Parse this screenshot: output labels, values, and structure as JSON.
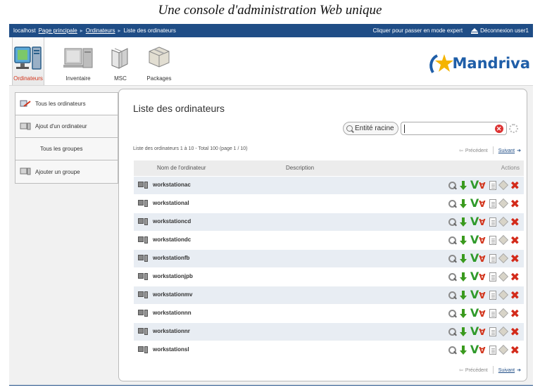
{
  "caption": "Une console d'administration Web unique",
  "topbar": {
    "host": "localhost",
    "crumb_home": "Page principale",
    "crumb_computers": "Ordinateurs",
    "crumb_current": "Liste des ordinateurs",
    "expert_link": "Cliquer pour passer en mode expert",
    "logout": "Déconnexion user1"
  },
  "modules": [
    {
      "label": "Ordinateurs",
      "icon": "computer-monitor-icon",
      "active": true
    },
    {
      "label": "Inventaire",
      "icon": "inventory-computers-icon",
      "active": false
    },
    {
      "label": "MSC",
      "icon": "msc-books-icon",
      "active": false
    },
    {
      "label": "Packages",
      "icon": "package-box-icon",
      "active": false
    }
  ],
  "brand": {
    "name": "Mandriva",
    "star_color": "#f5b400",
    "text_color": "#1f5ea8"
  },
  "sidebar": {
    "items": [
      {
        "label": "Tous les ordinateurs",
        "icon": "computers-list-icon",
        "selected": true
      },
      {
        "label": "Ajout d'un ordinateur",
        "icon": "add-computer-icon",
        "selected": false
      },
      {
        "label": "Tous les groupes",
        "icon": "",
        "selected": false
      },
      {
        "label": "Ajouter un groupe",
        "icon": "add-group-icon",
        "selected": false
      }
    ]
  },
  "main": {
    "title": "Liste des ordinateurs",
    "entity_label": "Entité racine",
    "search_value": "",
    "count_text": "Liste des ordinateurs 1 à 10 - Total 100 (page 1 / 10)",
    "prev_label": "Précédent",
    "next_label": "Suivant",
    "columns": {
      "name": "Nom de l'ordinateur",
      "description": "Description",
      "actions": "Actions"
    },
    "rows": [
      {
        "name": "workstationac",
        "description": ""
      },
      {
        "name": "workstational",
        "description": ""
      },
      {
        "name": "workstationcd",
        "description": ""
      },
      {
        "name": "workstationdc",
        "description": ""
      },
      {
        "name": "workstationfb",
        "description": ""
      },
      {
        "name": "workstationjpb",
        "description": ""
      },
      {
        "name": "workstationmv",
        "description": ""
      },
      {
        "name": "workstationnn",
        "description": ""
      },
      {
        "name": "workstationnr",
        "description": ""
      },
      {
        "name": "workstationsl",
        "description": ""
      }
    ],
    "row_actions": [
      "search-icon",
      "download-arrow-icon",
      "vnc-icon",
      "document-icon",
      "package-icon",
      "delete-icon"
    ]
  },
  "colors": {
    "topbar": "#1f4d86",
    "row_alt": "#e8edf3",
    "active_module_label": "#d2341b"
  }
}
